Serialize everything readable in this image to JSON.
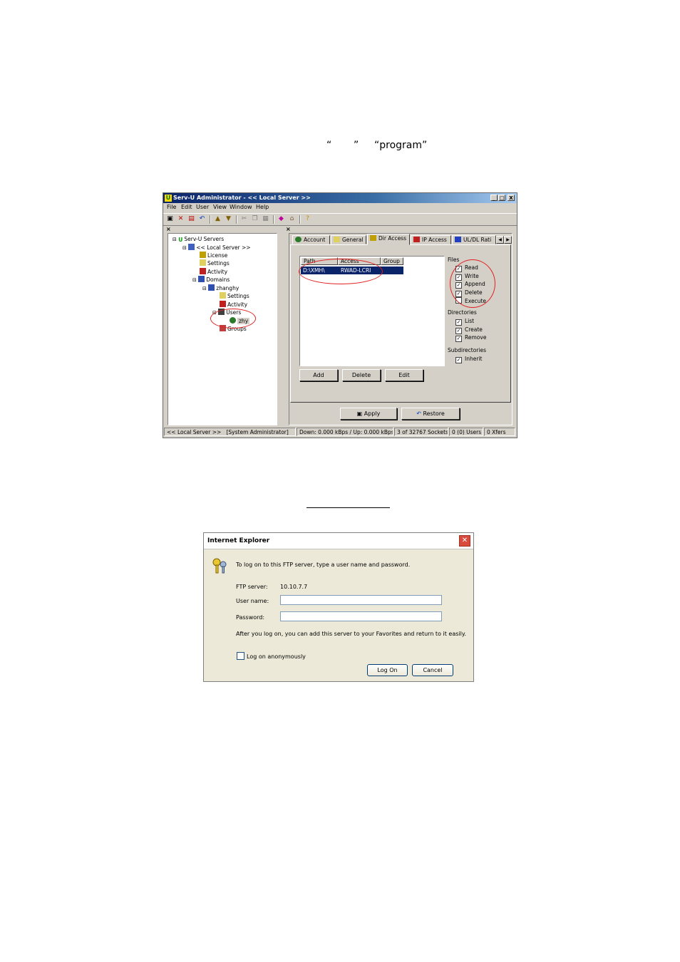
{
  "doc": {
    "quote_open": "“",
    "quote_close": "”",
    "quoted_word": "“program”"
  },
  "servu": {
    "title": "Serv-U Administrator - << Local Server >>",
    "window_buttons": [
      "_",
      "□",
      "X"
    ],
    "menu": [
      "File",
      "Edit",
      "User",
      "View",
      "Window",
      "Help"
    ],
    "tree": [
      {
        "label": "Serv-U Servers",
        "icon": "servu-u-icon",
        "level": 0
      },
      {
        "label": "<< Local Server >>",
        "icon": "computer-icon",
        "level": 1
      },
      {
        "label": "License",
        "icon": "key-icon",
        "level": 2
      },
      {
        "label": "Settings",
        "icon": "settings-icon",
        "level": 2
      },
      {
        "label": "Activity",
        "icon": "activity-icon",
        "level": 2
      },
      {
        "label": "Domains",
        "icon": "domains-icon",
        "level": 2
      },
      {
        "label": "zhanghy",
        "icon": "domain-icon",
        "level": 3
      },
      {
        "label": "Settings",
        "icon": "settings-icon",
        "level": 4
      },
      {
        "label": "Activity",
        "icon": "activity-icon",
        "level": 4
      },
      {
        "label": "Users",
        "icon": "users-icon",
        "level": 4
      },
      {
        "label": "zhy",
        "icon": "user-icon",
        "level": 5
      },
      {
        "label": "Groups",
        "icon": "groups-icon",
        "level": 4
      }
    ],
    "tabs": [
      "Account",
      "General",
      "Dir Access",
      "IP Access",
      "UL/DL Rati"
    ],
    "selected_tab": "Dir Access",
    "list_headers": [
      "Path",
      "Access",
      "Group"
    ],
    "list_row": {
      "path": "D:\\XMH\\",
      "access": "RWAD-LCRI",
      "group": ""
    },
    "files_label": "Files",
    "files": [
      {
        "label": "Read",
        "checked": true
      },
      {
        "label": "Write",
        "checked": true
      },
      {
        "label": "Append",
        "checked": true
      },
      {
        "label": "Delete",
        "checked": true
      },
      {
        "label": "Execute",
        "checked": false
      }
    ],
    "dirs_label": "Directories",
    "dirs": [
      {
        "label": "List",
        "checked": true
      },
      {
        "label": "Create",
        "checked": true
      },
      {
        "label": "Remove",
        "checked": true
      }
    ],
    "subdirs_label": "Subdirectories",
    "subdirs": [
      {
        "label": "Inherit",
        "checked": true
      }
    ],
    "buttons": {
      "add": "Add",
      "delete": "Delete",
      "edit": "Edit",
      "apply": "Apply",
      "restore": "Restore"
    },
    "status": [
      "<< Local Server >>",
      "[System Administrator]",
      "Down: 0.000 kBps / Up: 0.000 kBps",
      "3 of 32767 Sockets",
      "0 (0) Users",
      "0 Xfers"
    ]
  },
  "ie": {
    "title": "Internet Explorer",
    "intro": "To log on to this FTP server, type a user name and password.",
    "ftp_label": "FTP server:",
    "ftp_value": "10.10.7.7",
    "user_label": "User name:",
    "user_value": "",
    "pass_label": "Password:",
    "pass_value": "",
    "after_text": "After you log on, you can add this server to your Favorites and return to it easily.",
    "anon_label": "Log on anonymously",
    "anon_checked": false,
    "logon": "Log On",
    "cancel": "Cancel"
  },
  "colors": {
    "highlight_ring": "#e02020",
    "selection": "#0a246a",
    "title_bar": "#0a246a"
  }
}
